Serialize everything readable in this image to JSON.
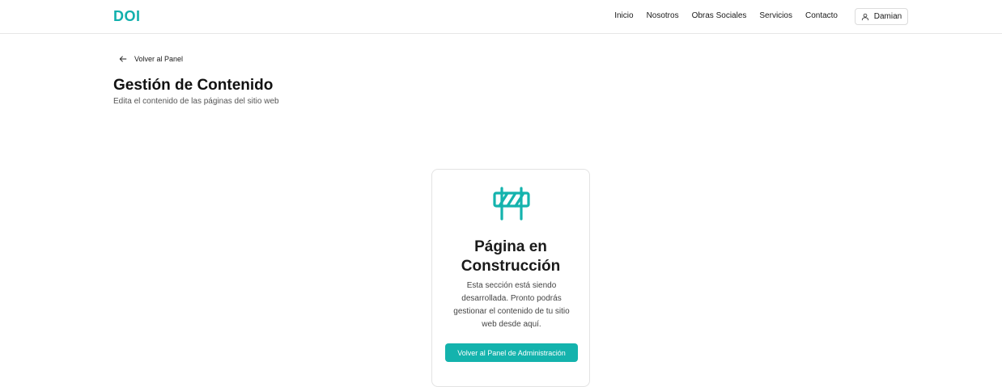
{
  "header": {
    "logo": "DOI",
    "nav": [
      "Inicio",
      "Nosotros",
      "Obras Sociales",
      "Servicios",
      "Contacto"
    ],
    "user_name": "Damian",
    "user_icon": "user-icon"
  },
  "back_link": {
    "label": "Volver al Panel",
    "icon": "arrow-left-icon"
  },
  "page": {
    "title": "Gestión de Contenido",
    "subtitle": "Edita el contenido de las páginas del sitio web"
  },
  "card": {
    "icon": "construction-barrier-icon",
    "title_line1": "Página en",
    "title_line2": "Construcción",
    "text": "Esta sección está siendo desarrollada. Pronto podrás gestionar el contenido de tu sitio web desde aquí.",
    "button_label": "Volver al Panel de Administración"
  },
  "colors": {
    "accent": "#14b3ad",
    "logo": "#12b0ad"
  }
}
